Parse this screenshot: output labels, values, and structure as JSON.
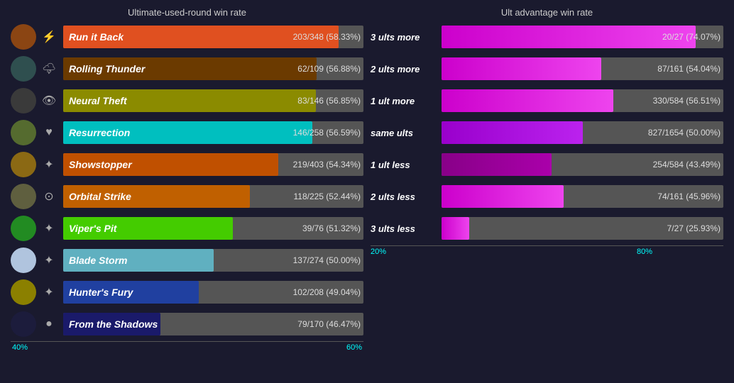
{
  "leftTitle": "Ultimate-used-round win rate",
  "rightTitle": "Ult advantage win rate",
  "leftAxisLabels": [
    "40%",
    "60%"
  ],
  "rightAxisLabels": [
    "20%",
    "80%"
  ],
  "leftBars": [
    {
      "name": "Run it Back",
      "value": "203/348 (58.33%)",
      "pct": 0.8333,
      "color": "#E05020",
      "avClass": "av1",
      "icon": "⚡"
    },
    {
      "name": "Rolling Thunder",
      "value": "62/109 (56.88%)",
      "pct": 0.73,
      "color": "#6B3A00",
      "avClass": "av2",
      "icon": "⚡"
    },
    {
      "name": "Neural Theft",
      "value": "83/146 (56.85%)",
      "pct": 0.729,
      "color": "#8B8B00",
      "avClass": "av3",
      "icon": "👁"
    },
    {
      "name": "Resurrection",
      "value": "146/258 (56.59%)",
      "pct": 0.72,
      "color": "#00BFBF",
      "avClass": "av4",
      "icon": "♥"
    },
    {
      "name": "Showstopper",
      "value": "219/403 (54.34%)",
      "pct": 0.607,
      "color": "#C05000",
      "avClass": "av5",
      "icon": "✦"
    },
    {
      "name": "Orbital Strike",
      "value": "118/225 (52.44%)",
      "pct": 0.488,
      "color": "#C06000",
      "avClass": "av6",
      "icon": "◎"
    },
    {
      "name": "Viper's Pit",
      "value": "39/76 (51.32%)",
      "pct": 0.396,
      "color": "#44CC00",
      "avClass": "av7",
      "icon": "✦"
    },
    {
      "name": "Blade Storm",
      "value": "137/274 (50.00%)",
      "pct": 0.33,
      "color": "#60B0C0",
      "avClass": "av8",
      "icon": "✦"
    },
    {
      "name": "Hunter's Fury",
      "value": "102/208 (49.04%)",
      "pct": 0.27,
      "color": "#2040A0",
      "avClass": "av9",
      "icon": "✦"
    },
    {
      "name": "From the Shadows",
      "value": "79/170 (46.47%)",
      "pct": 0.15,
      "color": "#1A1A6A",
      "avClass": "av10",
      "icon": "●"
    }
  ],
  "rightBars": [
    {
      "label": "3 ults more",
      "value": "20/27 (74.07%)",
      "pct": 0.9,
      "colorA": "#CC00CC",
      "colorB": "#EE44EE"
    },
    {
      "label": "2 ults more",
      "value": "87/161 (54.04%)",
      "pct": 0.55,
      "colorA": "#CC00CC",
      "colorB": "#EE44EE"
    },
    {
      "label": "1 ult more",
      "value": "330/584 (56.51%)",
      "pct": 0.72,
      "colorA": "#CC00CC",
      "colorB": "#EE44EE"
    },
    {
      "label": "same ults",
      "value": "827/1654 (50.00%)",
      "pct": 0.42,
      "colorA": "#9900CC",
      "colorB": "#BB22EE"
    },
    {
      "label": "1 ult less",
      "value": "254/584 (43.49%)",
      "pct": 0.25,
      "colorA": "#880088",
      "colorB": "#AA00AA"
    },
    {
      "label": "2 ults less",
      "value": "74/161 (45.96%)",
      "pct": 0.32,
      "colorA": "#CC00CC",
      "colorB": "#EE44EE"
    },
    {
      "label": "3 ults less",
      "value": "7/27 (25.93%)",
      "pct": 0.08,
      "colorA": "#CC00CC",
      "colorB": "#EE44EE"
    }
  ]
}
